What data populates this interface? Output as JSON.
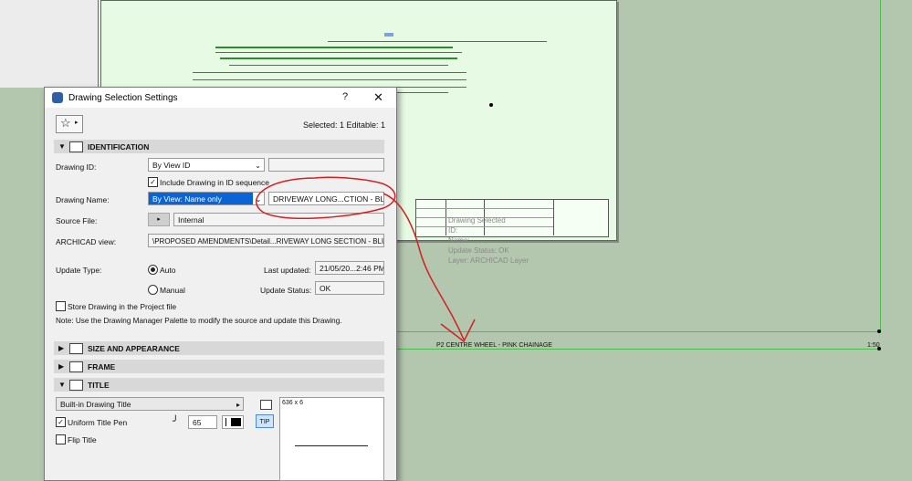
{
  "canvas": {
    "title_block_label": "P2 CENTRE WHEEL - PINK CHAINAGE",
    "scale_label": "1:50",
    "ghost_info": {
      "line1": "Drawing Selected",
      "line2": "ID:",
      "line3": "Name:",
      "line4": "Update Status: OK",
      "line5": "Layer: ARCHICAD Layer"
    }
  },
  "dialog": {
    "title": "Drawing Selection Settings",
    "help": "?",
    "close": "✕",
    "selected_info": "Selected: 1 Editable: 1",
    "sections": {
      "identification": "IDENTIFICATION",
      "size": "SIZE AND APPEARANCE",
      "frame": "FRAME",
      "title": "TITLE"
    },
    "drawing_id": {
      "label": "Drawing ID:",
      "value": "By View ID",
      "text": ""
    },
    "include_in_sequence": {
      "label": "Include Drawing in ID sequence",
      "checked": true
    },
    "drawing_name": {
      "label": "Drawing Name:",
      "value": "By View: Name only",
      "text": "DRIVEWAY LONG...CTION - BLUE"
    },
    "source_file": {
      "label": "Source File:",
      "value": "Internal"
    },
    "archicad_view": {
      "label": "ARCHICAD view:",
      "value": "\\PROPOSED AMENDMENTS\\Detail...RIVEWAY LONG SECTION - BLUE"
    },
    "update_type": {
      "label": "Update Type:",
      "auto": "Auto",
      "manual": "Manual",
      "selected": "Auto"
    },
    "last_updated": {
      "label": "Last updated:",
      "value": "21/05/20...2:46 PM"
    },
    "update_status": {
      "label": "Update Status:",
      "value": "OK"
    },
    "store_drawing": {
      "label": "Store Drawing in the Project file",
      "checked": false
    },
    "note": "Note: Use the Drawing Manager Palette to modify the source and update this Drawing.",
    "title_panel": {
      "type": "Built-in Drawing Title",
      "uniform_pen_label": "Uniform Title Pen",
      "uniform_pen_checked": true,
      "pen_value": "65",
      "flip_label": "Flip Title",
      "flip_checked": false,
      "tip_label": "TIP",
      "preview_size": "636 x 6"
    }
  },
  "colors": {
    "canvas_bg": "#b3c6ae",
    "sheet_bg": "#e6fae4",
    "selection_blue": "#0a64d6",
    "annotation_red": "#d42020"
  },
  "icons": [
    "star-icon",
    "help-icon",
    "close-icon",
    "identification-icon",
    "size-icon",
    "frame-icon",
    "title-icon",
    "pen-icon",
    "color-swatch-icon"
  ]
}
